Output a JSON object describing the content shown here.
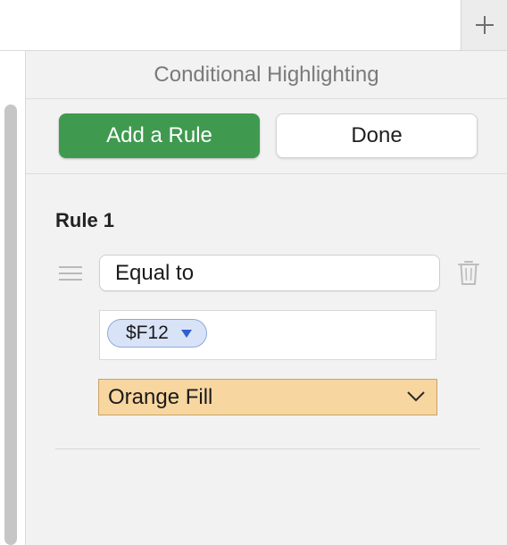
{
  "panel": {
    "title": "Conditional Highlighting",
    "add_rule_label": "Add a Rule",
    "done_label": "Done"
  },
  "rule": {
    "heading": "Rule 1",
    "condition": "Equal to",
    "value_token": "$F12",
    "style": "Orange Fill"
  },
  "colors": {
    "add_button": "#3f9a50",
    "orange_fill": "#f7d6a0",
    "token_bg": "#d9e3f7",
    "token_caret": "#2f5fd0"
  },
  "icons": {
    "new_tab": "plus-icon",
    "reorder": "drag-handle-icon",
    "delete": "trash-icon",
    "token_menu": "triangle-down-icon",
    "style_menu": "chevron-down-icon"
  }
}
